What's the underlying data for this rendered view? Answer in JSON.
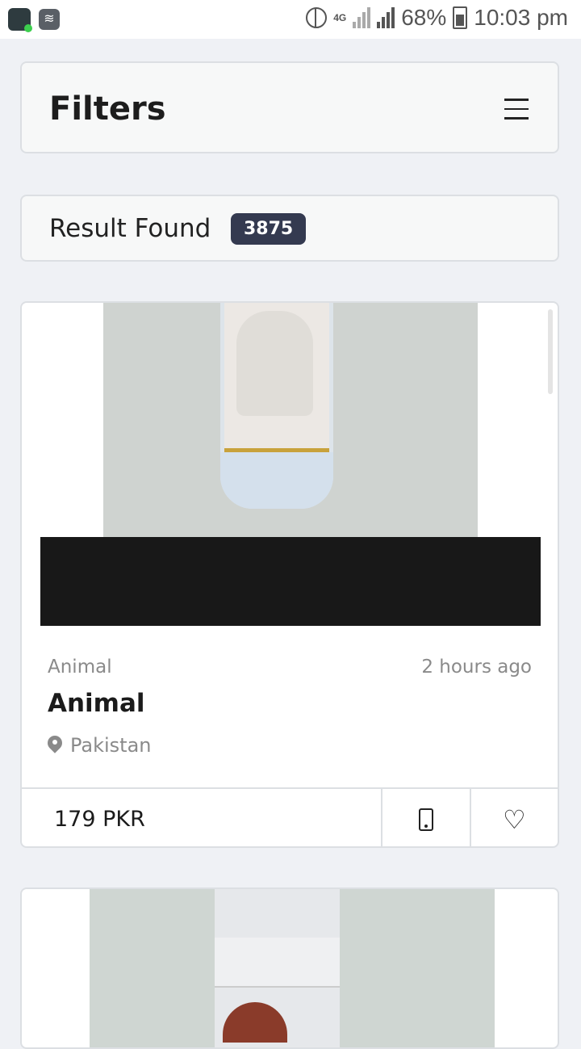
{
  "status_bar": {
    "network": "4G",
    "battery": "68%",
    "time": "10:03 pm",
    "icons": [
      "app-icon",
      "wifi-icon",
      "globe-icon",
      "signal-icon",
      "battery-icon"
    ]
  },
  "filters": {
    "title": "Filters",
    "menu_icon": "menu-icon"
  },
  "result": {
    "label": "Result Found",
    "count": "3875"
  },
  "listings": [
    {
      "category": "Animal",
      "time_ago": "2 hours ago",
      "title": "Animal",
      "location": "Pakistan",
      "price": "179 PKR",
      "call_icon": "phone-icon",
      "fav_icon": "heart-icon"
    }
  ],
  "colors": {
    "background": "#eff1f5",
    "badge": "#343a50",
    "muted_text": "#8a8a8a"
  }
}
